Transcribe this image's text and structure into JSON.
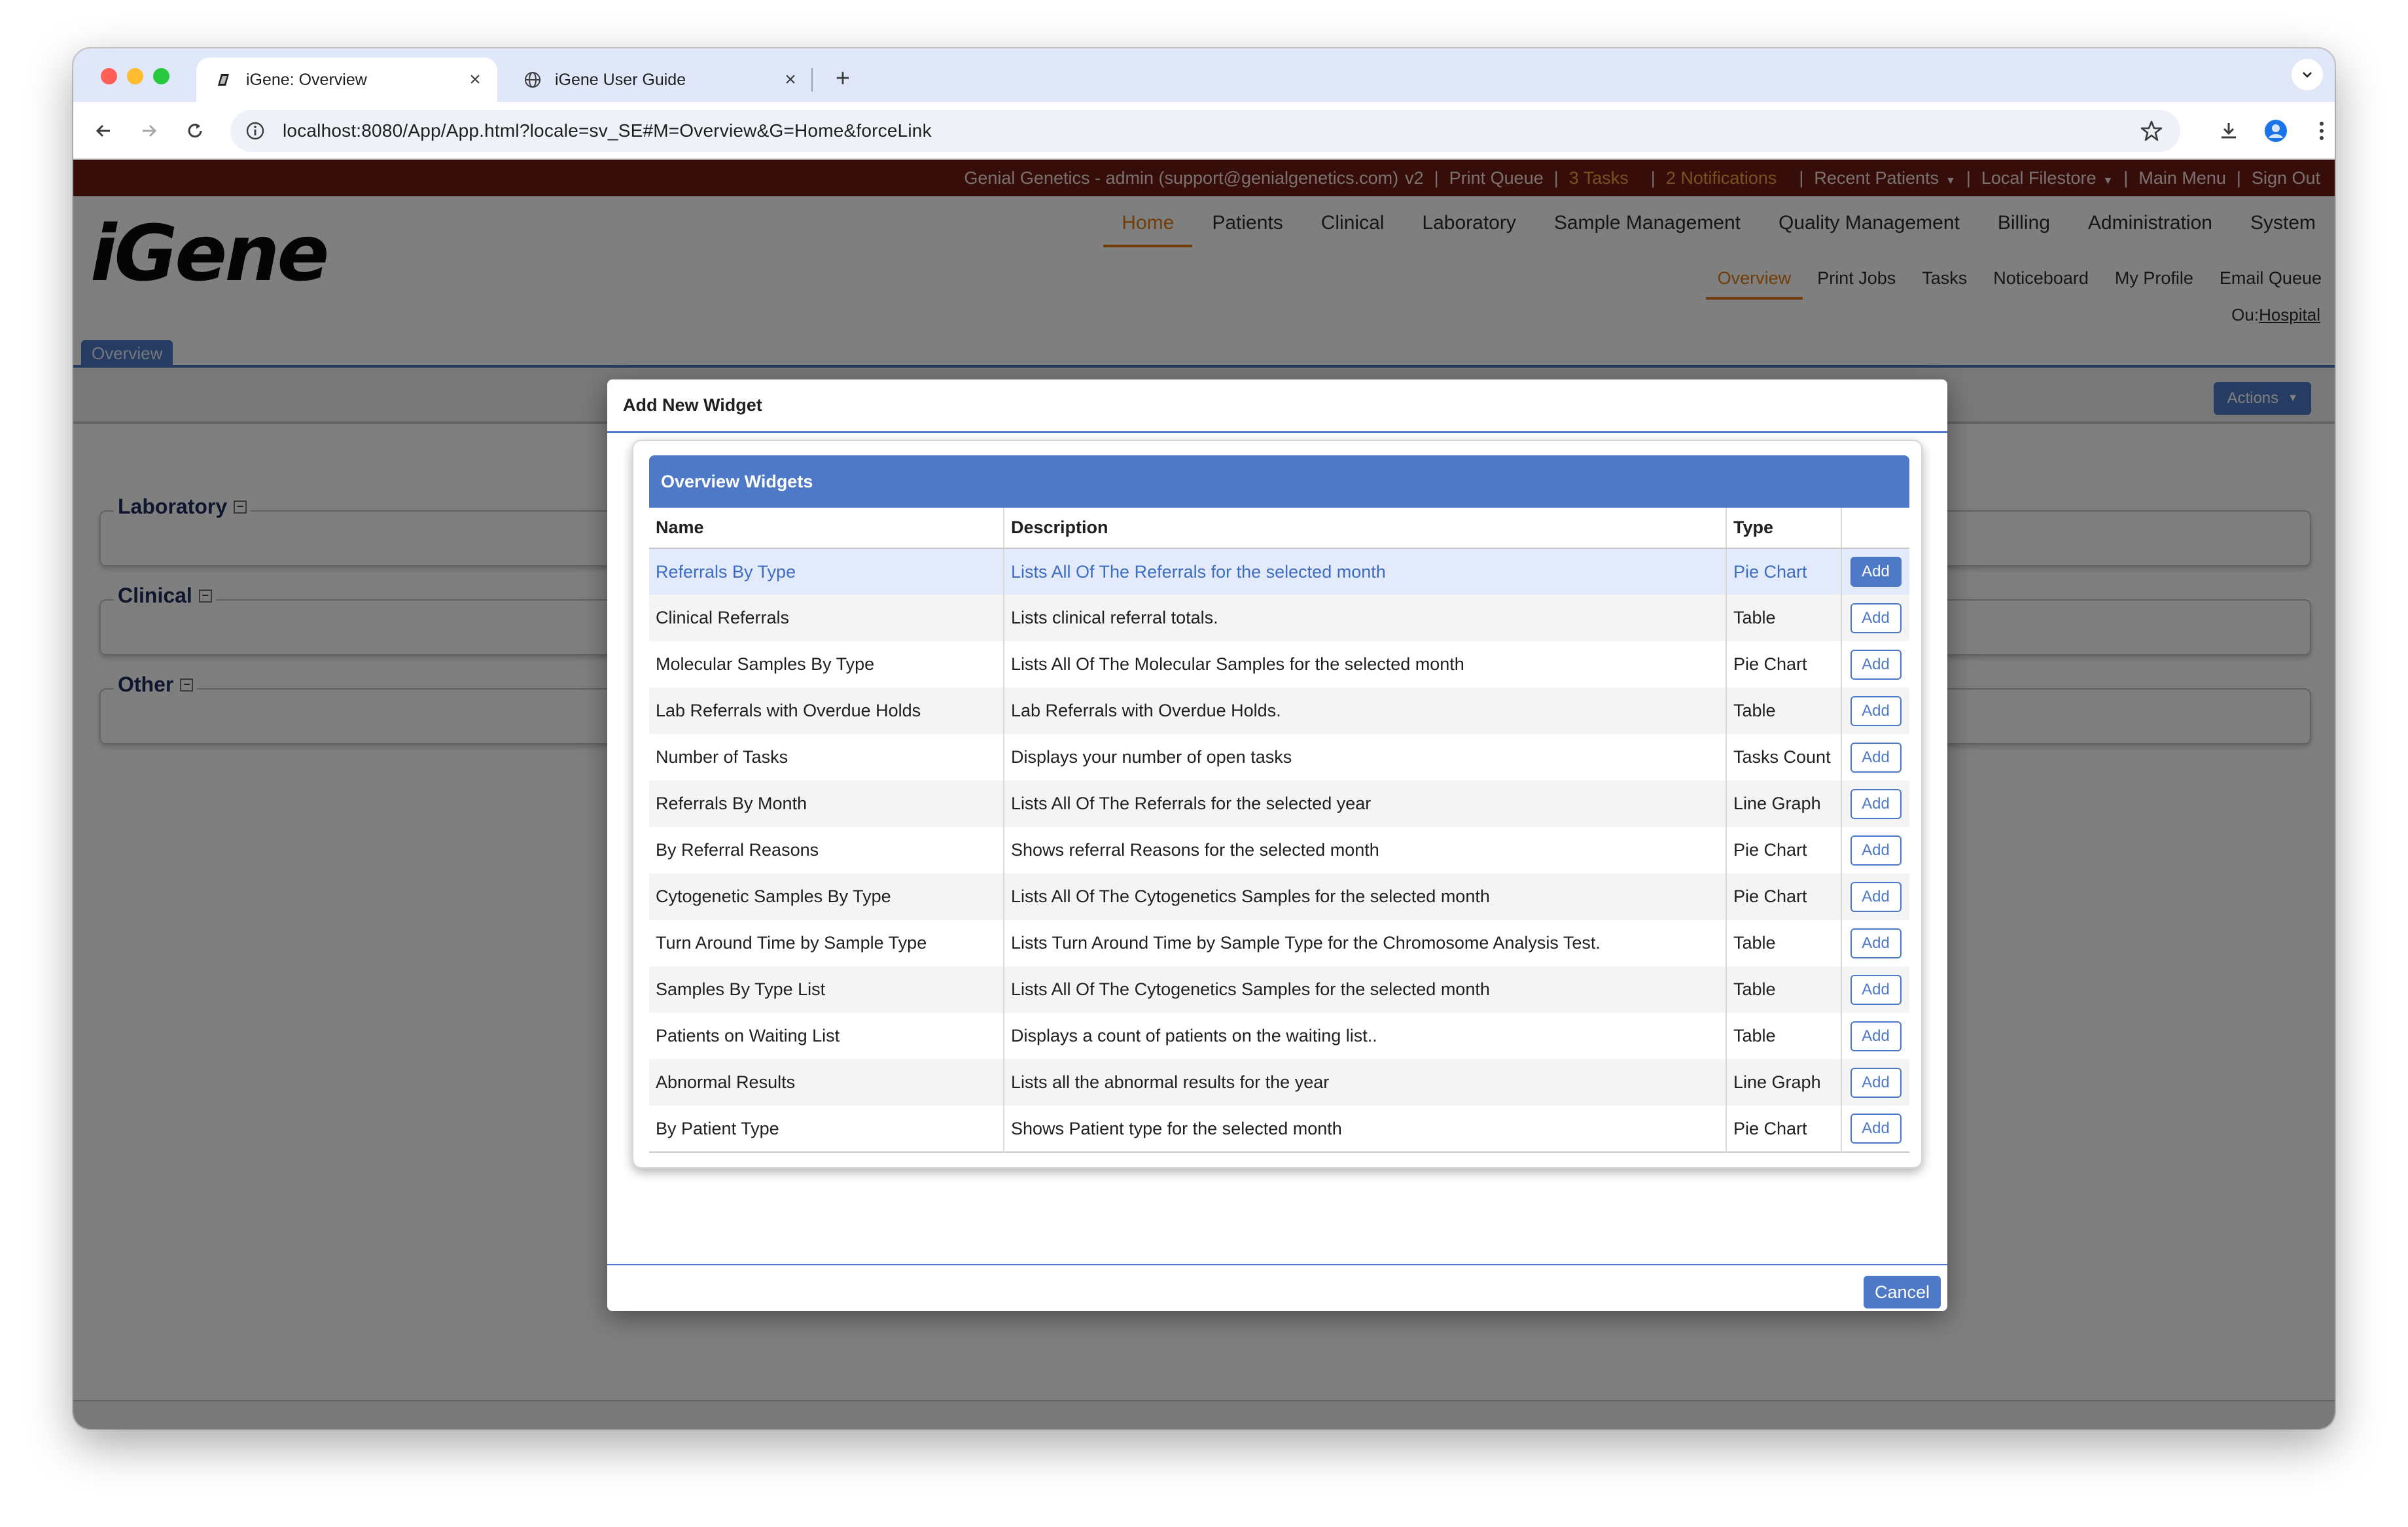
{
  "browser": {
    "tabs": [
      {
        "title": "iGene: Overview",
        "close_icon": "×"
      },
      {
        "title": "iGene User Guide",
        "close_icon": "×"
      }
    ],
    "new_tab_icon": "+",
    "url": "localhost:8080/App/App.html?locale=sv_SE#M=Overview&G=Home&forceLink"
  },
  "topbar": {
    "account": "Genial Genetics - admin (support@genialgenetics.com)",
    "version": "v2",
    "print_queue": "Print Queue",
    "tasks": "3 Tasks",
    "notifications": "2 Notifications",
    "recent_patients": "Recent Patients",
    "local_filestore": "Local Filestore",
    "main_menu": "Main Menu",
    "sign_out": "Sign Out",
    "separator": "|",
    "dropdown_arrow": "▼"
  },
  "app": {
    "logo": "iGene",
    "main_nav": [
      "Home",
      "Patients",
      "Clinical",
      "Laboratory",
      "Sample Management",
      "Quality Management",
      "Billing",
      "Administration",
      "System"
    ],
    "sub_nav": [
      "Overview",
      "Print Jobs",
      "Tasks",
      "Noticeboard",
      "My Profile",
      "Email Queue"
    ],
    "ou_label": "Ou:",
    "ou_value": "Hospital",
    "page_tab": "Overview",
    "actions_label": "Actions",
    "actions_arrow": "▼",
    "sections": [
      "Laboratory",
      "Clinical",
      "Other"
    ],
    "section_toggle": "−"
  },
  "dialog": {
    "title": "Add New Widget",
    "panel_title": "Overview Widgets",
    "columns": {
      "name": "Name",
      "description": "Description",
      "type": "Type"
    },
    "add_label": "Add",
    "cancel_label": "Cancel",
    "rows": [
      {
        "name": "Referrals By Type",
        "description": "Lists All Of The Referrals for the selected month",
        "type": "Pie Chart"
      },
      {
        "name": "Clinical Referrals",
        "description": "Lists clinical referral totals.",
        "type": "Table"
      },
      {
        "name": "Molecular Samples By Type",
        "description": "Lists All Of The Molecular Samples for the selected month",
        "type": "Pie Chart"
      },
      {
        "name": "Lab Referrals with Overdue Holds",
        "description": "Lab Referrals with Overdue Holds.",
        "type": "Table"
      },
      {
        "name": "Number of Tasks",
        "description": "Displays your number of open tasks",
        "type": "Tasks Count"
      },
      {
        "name": "Referrals By Month",
        "description": "Lists All Of The Referrals for the selected year",
        "type": "Line Graph"
      },
      {
        "name": "By Referral Reasons",
        "description": "Shows referral Reasons for the selected month",
        "type": "Pie Chart"
      },
      {
        "name": "Cytogenetic Samples By Type",
        "description": "Lists All Of The Cytogenetics Samples for the selected month",
        "type": "Pie Chart"
      },
      {
        "name": "Turn Around Time by Sample Type",
        "description": "Lists Turn Around Time by Sample Type for the Chromosome Analysis Test.",
        "type": "Table"
      },
      {
        "name": "Samples By Type List",
        "description": "Lists All Of The Cytogenetics Samples for the selected month",
        "type": "Table"
      },
      {
        "name": "Patients on Waiting List",
        "description": "Displays a count of patients on the waiting list..",
        "type": "Table"
      },
      {
        "name": "Abnormal Results",
        "description": "Lists all the abnormal results for the year",
        "type": "Line Graph"
      },
      {
        "name": "By Patient Type",
        "description": "Shows Patient type for the selected month",
        "type": "Pie Chart"
      }
    ]
  },
  "colors": {
    "brand_blue": "#4e79c6",
    "top_strip": "#6e1a13",
    "active_orange": "#e07a12",
    "highlight_orange": "#f2a23c"
  }
}
